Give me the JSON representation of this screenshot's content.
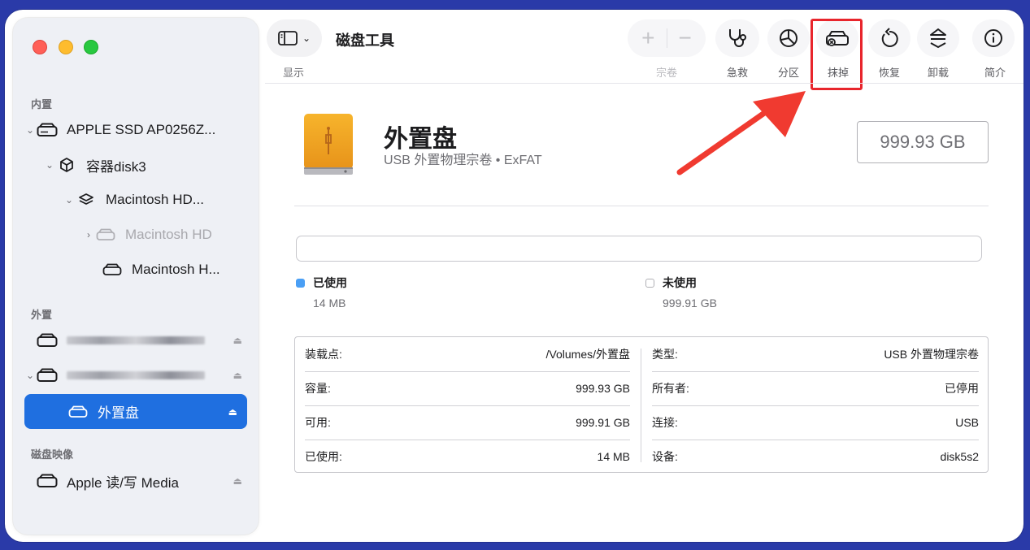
{
  "window": {
    "app_title": "磁盘工具"
  },
  "toolbar": {
    "view_label": "显示",
    "buttons": [
      {
        "label": "宗卷",
        "icon": "plus-minus-icon",
        "disabled": true
      },
      {
        "label": "急救",
        "icon": "stethoscope-icon"
      },
      {
        "label": "分区",
        "icon": "pie-chart-icon"
      },
      {
        "label": "抹掉",
        "icon": "erase-drive-icon"
      },
      {
        "label": "恢复",
        "icon": "restore-icon"
      },
      {
        "label": "卸载",
        "icon": "unmount-icon"
      },
      {
        "label": "简介",
        "icon": "info-icon"
      }
    ],
    "highlight_color": "#e8252c"
  },
  "sidebar": {
    "sections": {
      "internal": "内置",
      "external": "外置",
      "images": "磁盘映像"
    },
    "internal_items": [
      {
        "label": "APPLE SSD AP0256Z..."
      },
      {
        "label": "容器disk3"
      },
      {
        "label": "Macintosh HD..."
      },
      {
        "label": "Macintosh HD"
      },
      {
        "label": "Macintosh H..."
      }
    ],
    "external_items": [
      {
        "label": "外置盘",
        "selected": true
      }
    ],
    "image_items": [
      {
        "label": "Apple 读/写 Media"
      }
    ],
    "selected_color": "#1f6fe0"
  },
  "disk": {
    "name": "外置盘",
    "subtitle": "USB 外置物理宗卷 • ExFAT",
    "size": "999.93 GB"
  },
  "usage": {
    "used_label": "已使用",
    "used_value": "14 MB",
    "used_color": "#4a9ff5",
    "free_label": "未使用",
    "free_value": "999.91 GB"
  },
  "info_left": [
    {
      "key": "装载点:",
      "value": "/Volumes/外置盘"
    },
    {
      "key": "容量:",
      "value": "999.93 GB"
    },
    {
      "key": "可用:",
      "value": "999.91 GB"
    },
    {
      "key": "已使用:",
      "value": "14 MB"
    }
  ],
  "info_right": [
    {
      "key": "类型:",
      "value": "USB 外置物理宗卷"
    },
    {
      "key": "所有者:",
      "value": "已停用"
    },
    {
      "key": "连接:",
      "value": "USB"
    },
    {
      "key": "设备:",
      "value": "disk5s2"
    }
  ]
}
